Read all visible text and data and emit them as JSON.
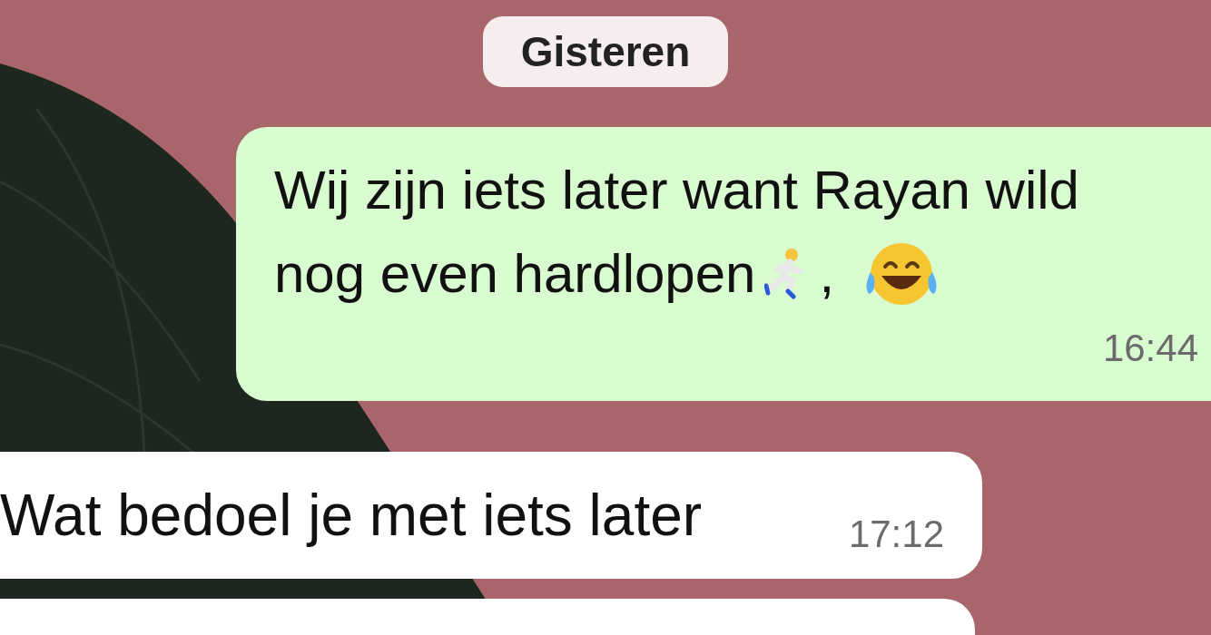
{
  "date_chip": "Gisteren",
  "messages": [
    {
      "kind": "outgoing",
      "lines": [
        "Wij zijn iets later want Rayan wild",
        "nog even hardlopen"
      ],
      "emoji": [
        {
          "kind": "runner"
        },
        {
          "kind": "laughing"
        }
      ],
      "punctuation": ",",
      "time": "16:44"
    },
    {
      "kind": "incoming",
      "lines": [
        "Wat bedoel je met iets later"
      ],
      "time": "17:12"
    },
    {
      "kind": "incoming-cut"
    }
  ]
}
